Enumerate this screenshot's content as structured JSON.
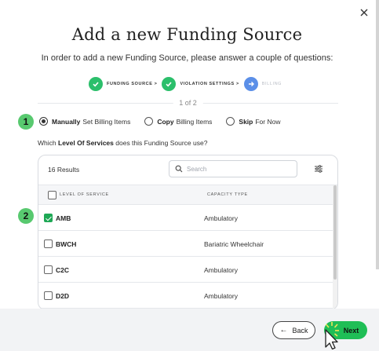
{
  "dialog": {
    "title": "Add a new Funding Source",
    "subtitle": "In order to add a new Funding Source, please answer a couple of questions:",
    "close_icon": "close-icon"
  },
  "stepper": {
    "steps": [
      {
        "label": "FUNDING SOURCE >",
        "status": "done",
        "icon": "check-icon"
      },
      {
        "label": "VIOLATION SETTINGS >",
        "status": "done",
        "icon": "check-icon"
      },
      {
        "label": "BILLING",
        "status": "current",
        "icon": "arrow-right-icon"
      }
    ]
  },
  "page_indicator": "1 of 2",
  "badges": [
    "1",
    "2"
  ],
  "billing_options": [
    {
      "bold": "Manually",
      "rest": "Set Billing Items",
      "selected": true
    },
    {
      "bold": "Copy",
      "rest": "Billing Items",
      "selected": false
    },
    {
      "bold": "Skip",
      "rest": "For Now",
      "selected": false
    }
  ],
  "question": {
    "prefix": "Which",
    "bold": "Level Of Services",
    "suffix": "does this Funding Source use?"
  },
  "table": {
    "results_label": "16 Results",
    "search_placeholder": "Search",
    "columns": [
      "LEVEL OF SERVICE",
      "CAPACITY TYPE"
    ],
    "rows": [
      {
        "code": "AMB",
        "capacity": "Ambulatory",
        "checked": true
      },
      {
        "code": "BWCH",
        "capacity": "Bariatric Wheelchair",
        "checked": false
      },
      {
        "code": "C2C",
        "capacity": "Ambulatory",
        "checked": false
      },
      {
        "code": "D2D",
        "capacity": "Ambulatory",
        "checked": false
      }
    ]
  },
  "footer": {
    "back_label": "Back",
    "next_label": "Next"
  },
  "colors": {
    "accent_green": "#1fbe56",
    "step_done": "#2bbf6b",
    "step_current": "#5b8fe8",
    "badge": "#58c96f"
  }
}
